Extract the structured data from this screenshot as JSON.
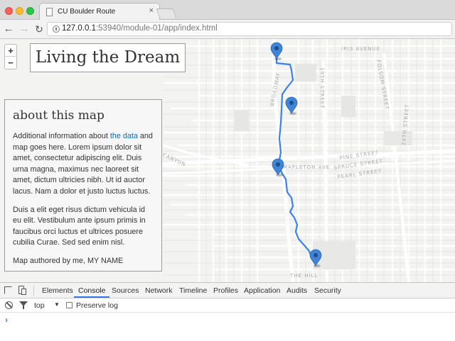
{
  "browser": {
    "tab_title": "CU Boulder Route",
    "tab_close": "×",
    "url_host": "127.0.0.1",
    "url_path": ":53940/module-01/app/index.html",
    "back": "←",
    "forward": "→",
    "reload": "↻"
  },
  "map": {
    "title": "Living the Dream",
    "zoom_in": "+",
    "zoom_out": "−",
    "street_labels": {
      "iris": "IRIS AVENUE",
      "broadway": "BROADWAY",
      "nineteenth": "19TH STREET",
      "folsom": "FOLSOM STREET",
      "mapleton": "MAPLETON AVE",
      "pine": "PINE STREET",
      "spruce": "SPRUCE STREET",
      "pearl": "PEARL STREET",
      "twentyfourth": "24TH STREET",
      "canyon": "CANYON",
      "the_hill": "THE HILL"
    },
    "marker_count": 4
  },
  "info": {
    "heading": "about this map",
    "p1_before": "Additional information about ",
    "p1_link": "the data",
    "p1_after": " and map goes here. Lorem ipsum dolor sit amet, consectetur adipiscing elit. Duis urna magna, maximus nec laoreet sit amet, dictum ultricies nibh. Ut id auctor lacus. Nam a dolor et justo luctus luctus.",
    "p2": "Duis a elit eget risus dictum vehicula id eu elit. Vestibulum ante ipsum primis in faucibus orci luctus et ultrices posuere cubilia Curae. Sed sed enim nisl.",
    "p3": "Map authored by me, MY NAME"
  },
  "devtools": {
    "tabs": [
      "Elements",
      "Console",
      "Sources",
      "Network",
      "Timeline",
      "Profiles",
      "Application",
      "Audits",
      "Security"
    ],
    "active_tab": "Console",
    "context": "top",
    "context_arrow": "▼",
    "preserve_log": "Preserve log",
    "prompt": "›"
  },
  "colors": {
    "route": "#3b82e8",
    "marker": "#3f84d6",
    "link": "#0a6ab8",
    "devtools_accent": "#3879d9"
  }
}
